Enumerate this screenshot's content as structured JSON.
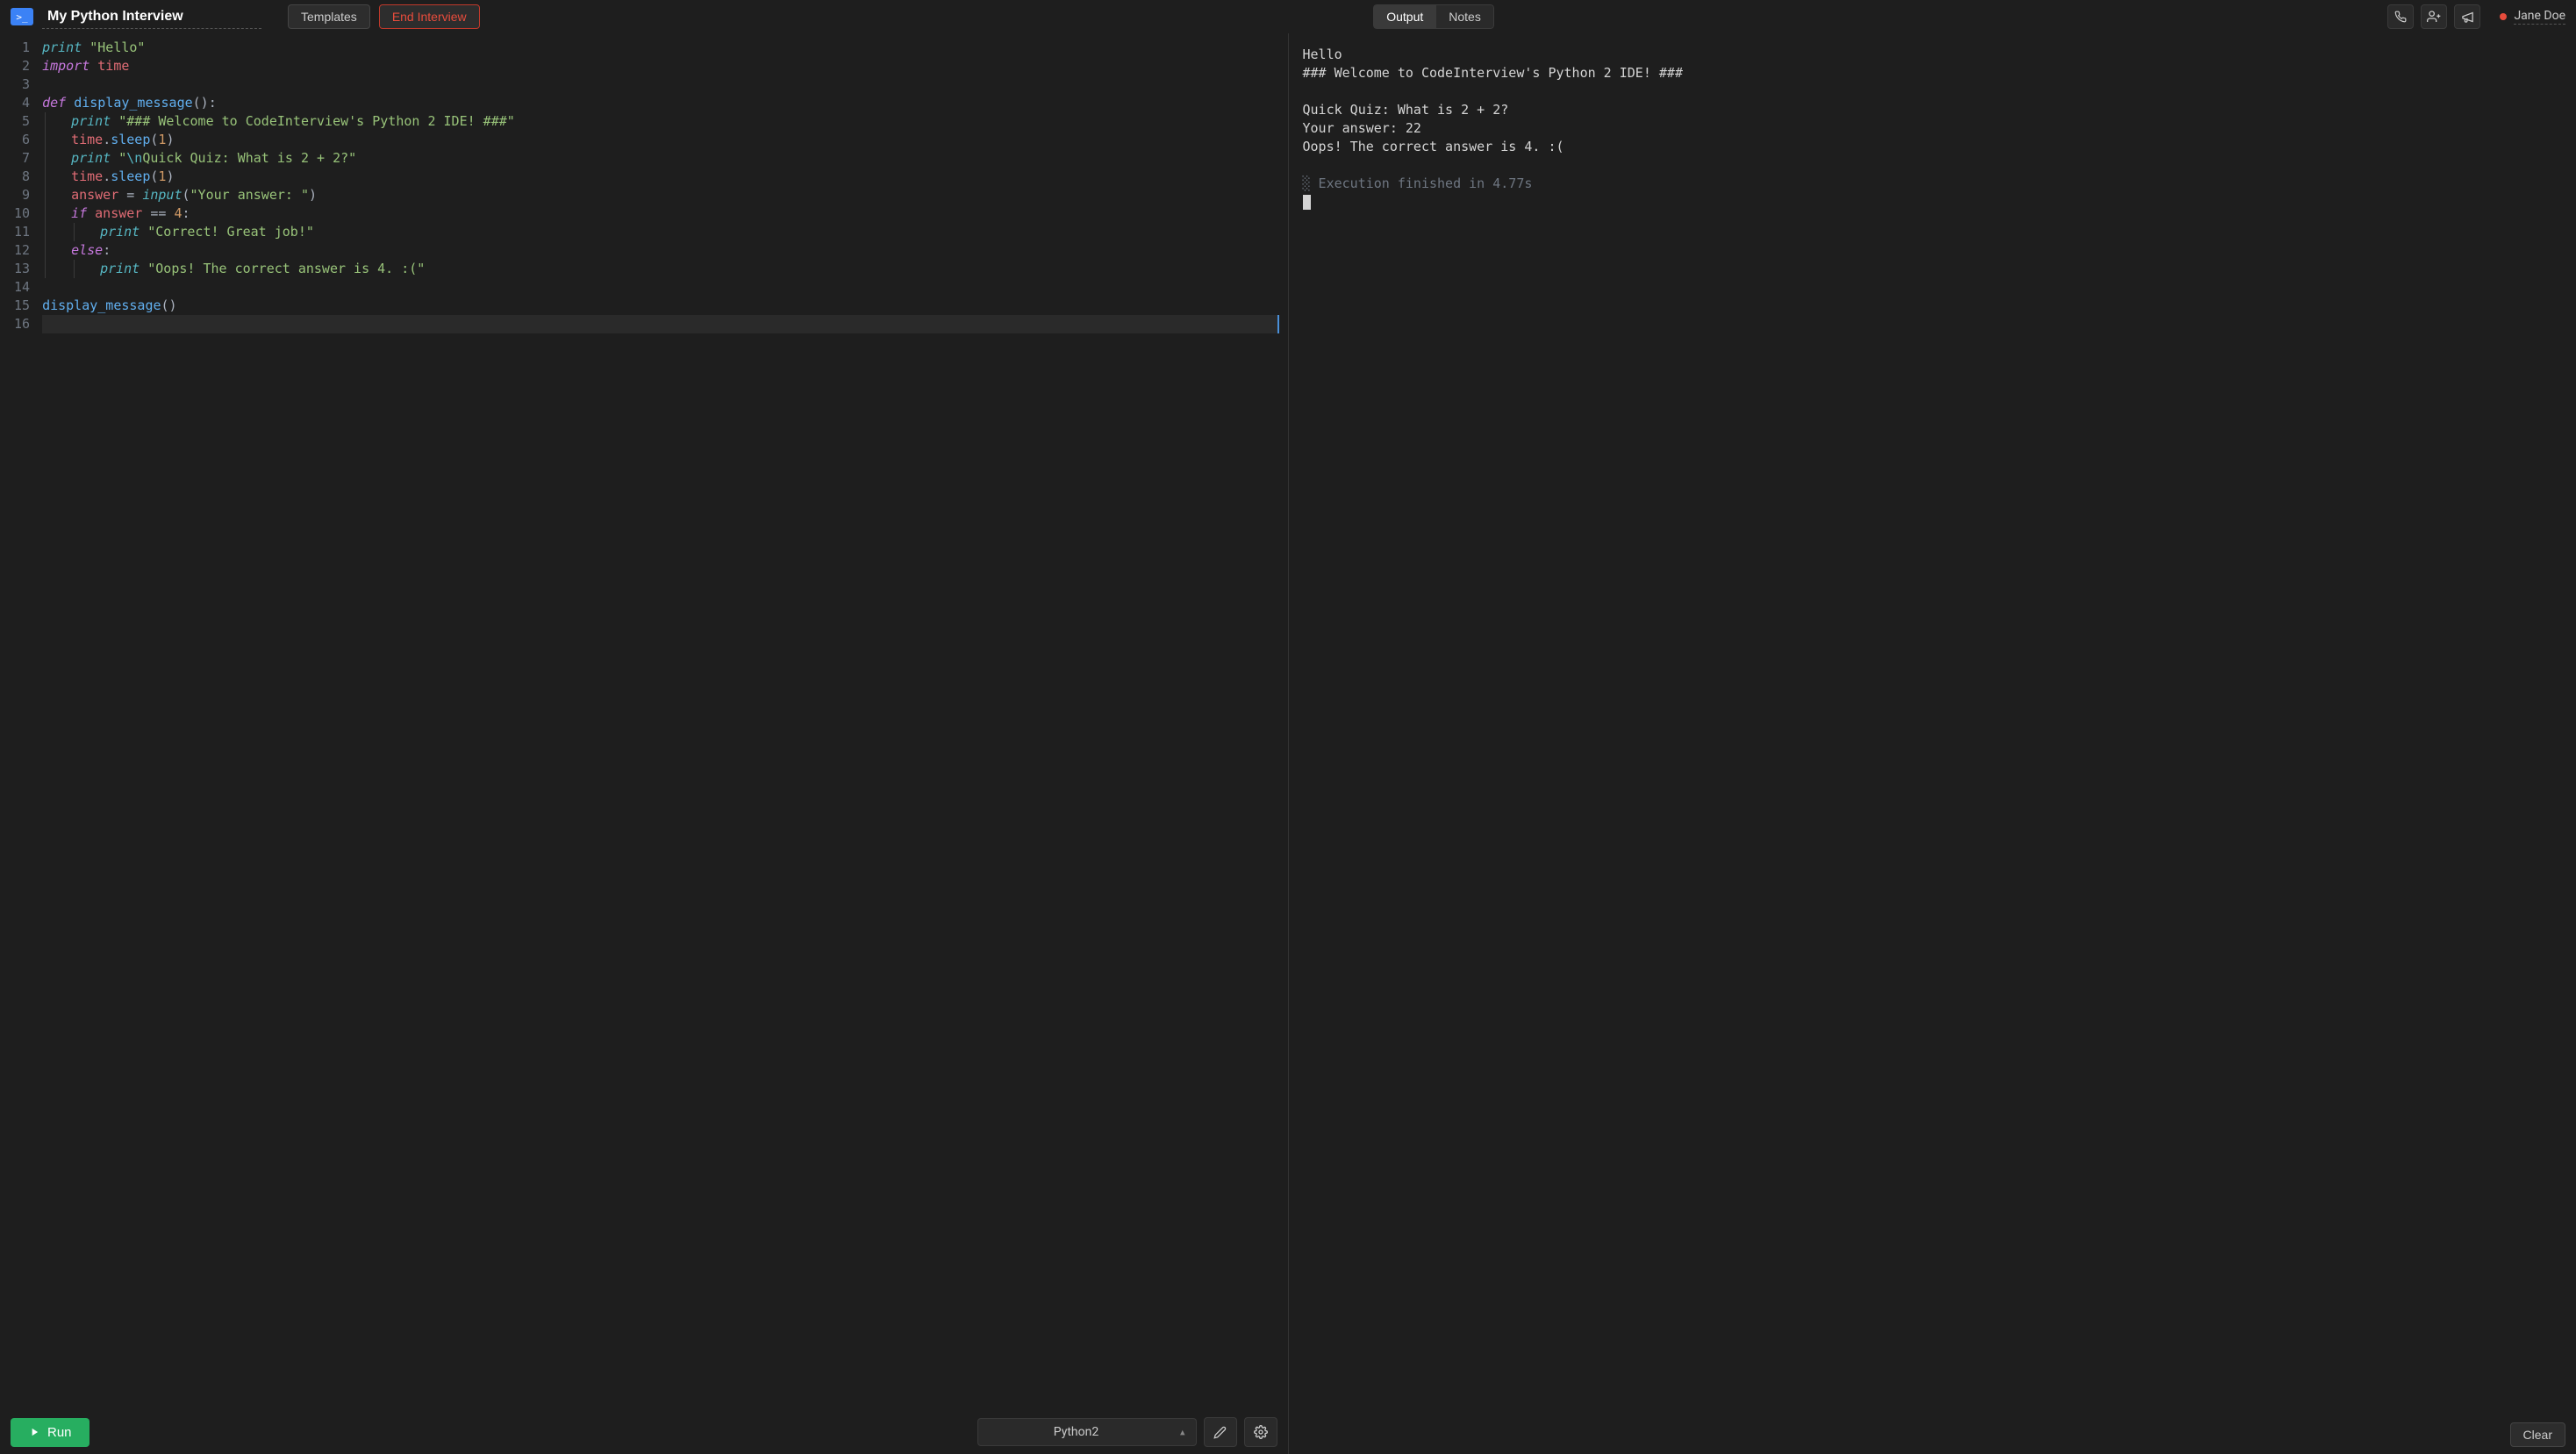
{
  "header": {
    "title": "My Python Interview",
    "templates_label": "Templates",
    "end_interview_label": "End Interview",
    "tabs": {
      "output": "Output",
      "notes": "Notes"
    },
    "user": "Jane Doe"
  },
  "editor": {
    "line_count": 16,
    "current_line": 16,
    "language": "Python2"
  },
  "code_tokens": [
    [
      [
        "builtin",
        "print"
      ],
      [
        "plain",
        " "
      ],
      [
        "str",
        "\"Hello\""
      ]
    ],
    [
      [
        "kw",
        "import"
      ],
      [
        "plain",
        " "
      ],
      [
        "id",
        "time"
      ]
    ],
    [],
    [
      [
        "kw",
        "def"
      ],
      [
        "plain",
        " "
      ],
      [
        "fn",
        "display_message"
      ],
      [
        "punct",
        "():"
      ]
    ],
    [
      [
        "indent",
        1
      ],
      [
        "builtin",
        "print"
      ],
      [
        "plain",
        " "
      ],
      [
        "str",
        "\"### Welcome to CodeInterview's Python 2 IDE! ###\""
      ]
    ],
    [
      [
        "indent",
        1
      ],
      [
        "id",
        "time"
      ],
      [
        "punct",
        "."
      ],
      [
        "fn",
        "sleep"
      ],
      [
        "punct",
        "("
      ],
      [
        "num",
        "1"
      ],
      [
        "punct",
        ")"
      ]
    ],
    [
      [
        "indent",
        1
      ],
      [
        "builtin",
        "print"
      ],
      [
        "plain",
        " "
      ],
      [
        "str",
        "\""
      ],
      [
        "esc",
        "\\n"
      ],
      [
        "str",
        "Quick Quiz: What is 2 + 2?\""
      ]
    ],
    [
      [
        "indent",
        1
      ],
      [
        "id",
        "time"
      ],
      [
        "punct",
        "."
      ],
      [
        "fn",
        "sleep"
      ],
      [
        "punct",
        "("
      ],
      [
        "num",
        "1"
      ],
      [
        "punct",
        ")"
      ]
    ],
    [
      [
        "indent",
        1
      ],
      [
        "id",
        "answer"
      ],
      [
        "plain",
        " "
      ],
      [
        "punct",
        "="
      ],
      [
        "plain",
        " "
      ],
      [
        "builtin",
        "input"
      ],
      [
        "punct",
        "("
      ],
      [
        "str",
        "\"Your answer: \""
      ],
      [
        "punct",
        ")"
      ]
    ],
    [
      [
        "indent",
        1
      ],
      [
        "kw",
        "if"
      ],
      [
        "plain",
        " "
      ],
      [
        "id",
        "answer"
      ],
      [
        "plain",
        " "
      ],
      [
        "punct",
        "=="
      ],
      [
        "plain",
        " "
      ],
      [
        "num",
        "4"
      ],
      [
        "punct",
        ":"
      ]
    ],
    [
      [
        "indent",
        2
      ],
      [
        "builtin",
        "print"
      ],
      [
        "plain",
        " "
      ],
      [
        "str",
        "\"Correct! Great job!\""
      ]
    ],
    [
      [
        "indent",
        1
      ],
      [
        "kw",
        "else"
      ],
      [
        "punct",
        ":"
      ]
    ],
    [
      [
        "indent",
        2
      ],
      [
        "builtin",
        "print"
      ],
      [
        "plain",
        " "
      ],
      [
        "str",
        "\"Oops! The correct answer is 4. :(\""
      ]
    ],
    [],
    [
      [
        "fn",
        "display_message"
      ],
      [
        "punct",
        "()"
      ]
    ],
    []
  ],
  "output": {
    "lines": [
      "Hello",
      "### Welcome to CodeInterview's Python 2 IDE! ###",
      "",
      "Quick Quiz: What is 2 + 2?",
      "Your answer: 22",
      "Oops! The correct answer is 4. :("
    ],
    "status_prefix": "░ Execution finished in ",
    "status_time": "4.77s"
  },
  "footer": {
    "run_label": "Run",
    "clear_label": "Clear"
  }
}
